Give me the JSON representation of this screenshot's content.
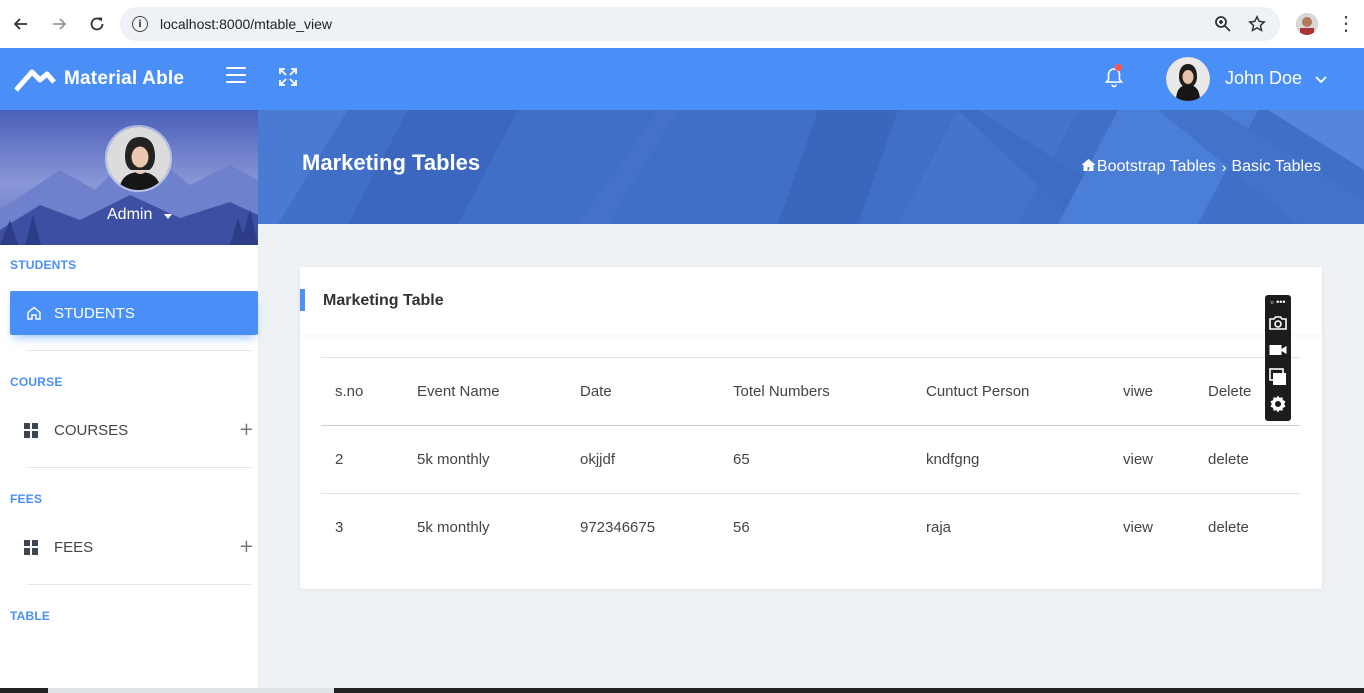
{
  "browser": {
    "url": "localhost:8000/mtable_view",
    "info_glyph": "i",
    "menu_glyph": "⋮"
  },
  "header": {
    "brand": "Material Able",
    "user_name": "John Doe",
    "accent_color": "#4a8ff8",
    "notification_dot_color": "#ff5252"
  },
  "sidebar": {
    "admin_name": "Admin",
    "sections": [
      {
        "label": "STUDENTS"
      },
      {
        "label": "COURSE"
      },
      {
        "label": "FEES"
      },
      {
        "label": "TABLE"
      }
    ],
    "items": [
      {
        "label": "STUDENTS",
        "icon": "home-icon",
        "active": true
      },
      {
        "label": "COURSES",
        "icon": "grid-icon",
        "expand": "+"
      },
      {
        "label": "FEES",
        "icon": "grid-icon",
        "expand": "+"
      }
    ]
  },
  "banner": {
    "title": "Marketing Tables",
    "breadcrumb": [
      "Bootstrap Tables",
      "Basic Tables"
    ],
    "separator": "›"
  },
  "card": {
    "title": "Marketing Table",
    "columns": [
      "s.no",
      "Event Name",
      "Date",
      "Totel Numbers",
      "Cuntuct Person",
      "viwe",
      "Delete"
    ],
    "rows": [
      [
        "2",
        "5k monthly",
        "okjjdf",
        "65",
        "kndfgng",
        "view",
        "delete"
      ],
      [
        "3",
        "5k monthly",
        "972346675",
        "56",
        "raja",
        "view",
        "delete"
      ]
    ]
  },
  "float_toolbar": {
    "top_glyph": "▫ •••",
    "icons": [
      "camera-icon",
      "video-icon",
      "windows-icon",
      "settings-icon"
    ]
  }
}
